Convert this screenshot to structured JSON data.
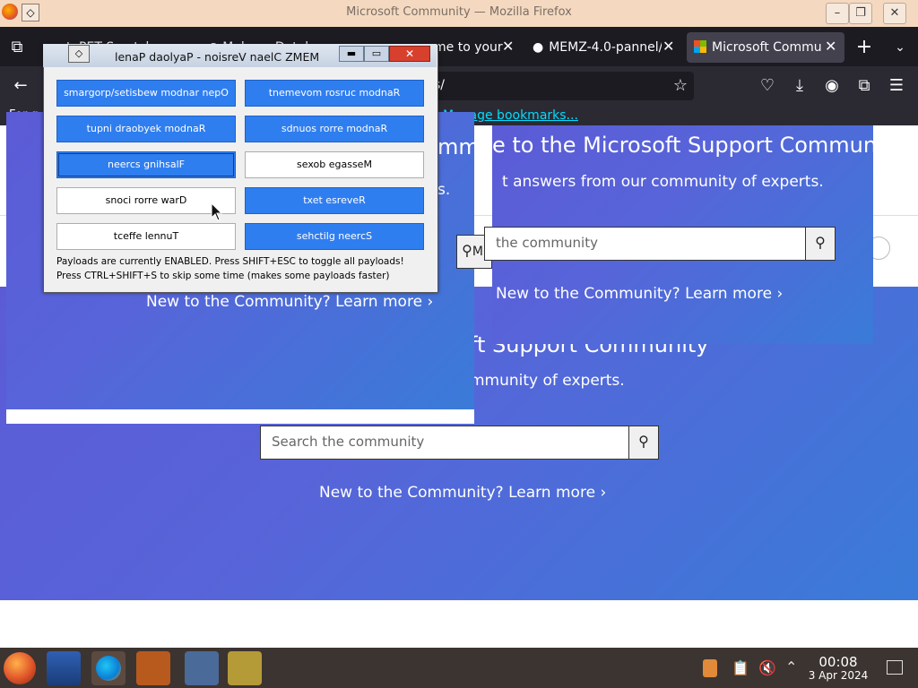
{
  "window": {
    "title": "Microsoft Community — Mozilla Firefox",
    "controls": [
      "–",
      "❐",
      "✕"
    ]
  },
  "tabs": [
    {
      "label": "toPET Scratch",
      "active": false
    },
    {
      "label": "MalwareDatabas",
      "active": false
    },
    {
      "label": "me to your",
      "active": false
    },
    {
      "label": "MEMZ-4.0-pannel/",
      "active": false
    },
    {
      "label": "Microsoft Commu",
      "active": true
    }
  ],
  "nav": {
    "url_fragment": "s/",
    "bookmarks_prefix": "For g",
    "manage_bookmarks": "Manage bookmarks..."
  },
  "page": {
    "heading_fragment_1": "e to the Microsoft Support Community",
    "subheading_fragment_1": "t answers from our community of experts.",
    "search_fragment_1": "the community",
    "learn_more_1": "New to the Community?  Learn more",
    "heading_fragment_2": "ft Support Community",
    "subheading_fragment_2": "mmunity of experts.",
    "search_placeholder": "Search the community",
    "learn_more_2": "New to the Community?  Learn more",
    "learn_more_3": "New to the Community?  Learn more",
    "heading_fragment_3": "mmu",
    "subheading_fragment_3": "s.",
    "search_fragment_3": "Mi",
    "search_icon": "search-icon",
    "chevron": "›"
  },
  "memz": {
    "title": "lenaP daolyaP - noisreV naelC ZMEM",
    "buttons": [
      {
        "label": "smargorp/setisbew modnar nepO",
        "state": "on"
      },
      {
        "label": "tnemevom rosruc modnaR",
        "state": "on"
      },
      {
        "label": "tupni draobyek modnaR",
        "state": "on"
      },
      {
        "label": "sdnuos rorre modnaR",
        "state": "on"
      },
      {
        "label": "neercs gnihsalF",
        "state": "on"
      },
      {
        "label": "sexob egasseM",
        "state": "off"
      },
      {
        "label": "snoci rorre warD",
        "state": "off"
      },
      {
        "label": "txet esreveR",
        "state": "on"
      },
      {
        "label": "tceffe lennuT",
        "state": "off"
      },
      {
        "label": "sehctilg neercS",
        "state": "on"
      }
    ],
    "status_line_1": "Payloads are currently ENABLED. Press SHIFT+ESC to toggle all payloads!",
    "status_line_2": "Press CTRL+SHIFT+S to skip some time (makes some payloads faster)"
  },
  "taskbar": {
    "clock_time": "00:08",
    "clock_date": "3 Apr 2024"
  },
  "colors": {
    "payload_on": "#2f7ef0",
    "hero_start": "#5b5bd6",
    "hero_end": "#3a7bd8",
    "taskbar": "#3c3430"
  }
}
